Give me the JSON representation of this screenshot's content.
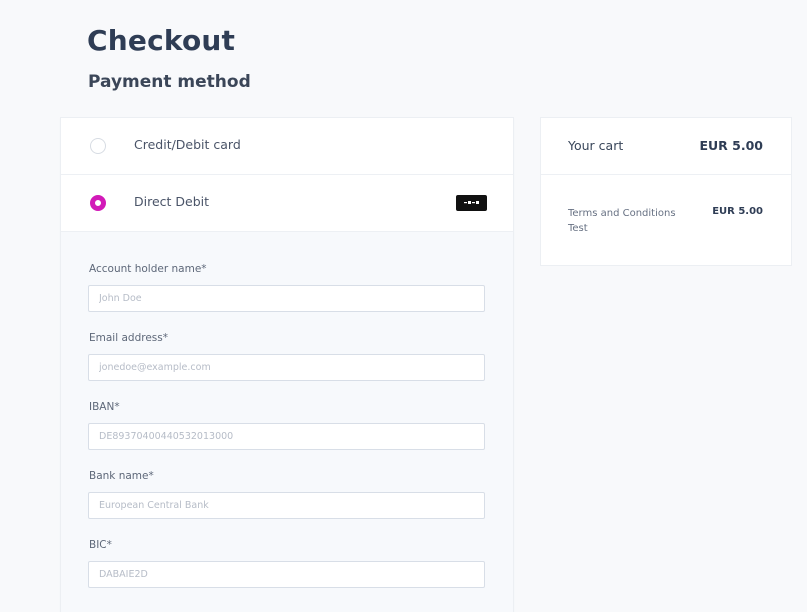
{
  "header": {
    "title": "Checkout",
    "subtitle": "Payment method"
  },
  "payment_methods": [
    {
      "label": "Credit/Debit card",
      "selected": false
    },
    {
      "label": "Direct Debit",
      "selected": true,
      "icon": "sepa-logo-icon"
    }
  ],
  "debit_form": {
    "fields": [
      {
        "label": "Account holder name*",
        "placeholder": "John Doe"
      },
      {
        "label": "Email address*",
        "placeholder": "jonedoe@example.com"
      },
      {
        "label": "IBAN*",
        "placeholder": "DE89370400440532013000"
      },
      {
        "label": "Bank name*",
        "placeholder": "European Central Bank"
      },
      {
        "label": "BIC*",
        "placeholder": "DABAIE2D"
      }
    ]
  },
  "cart": {
    "title": "Your cart",
    "total": "EUR 5.00",
    "item_name": "Terms and Conditions Test",
    "item_price": "EUR 5.00"
  },
  "colors": {
    "accent": "#d21ab8",
    "background": "#f8f9fb",
    "panel": "#ffffff"
  }
}
